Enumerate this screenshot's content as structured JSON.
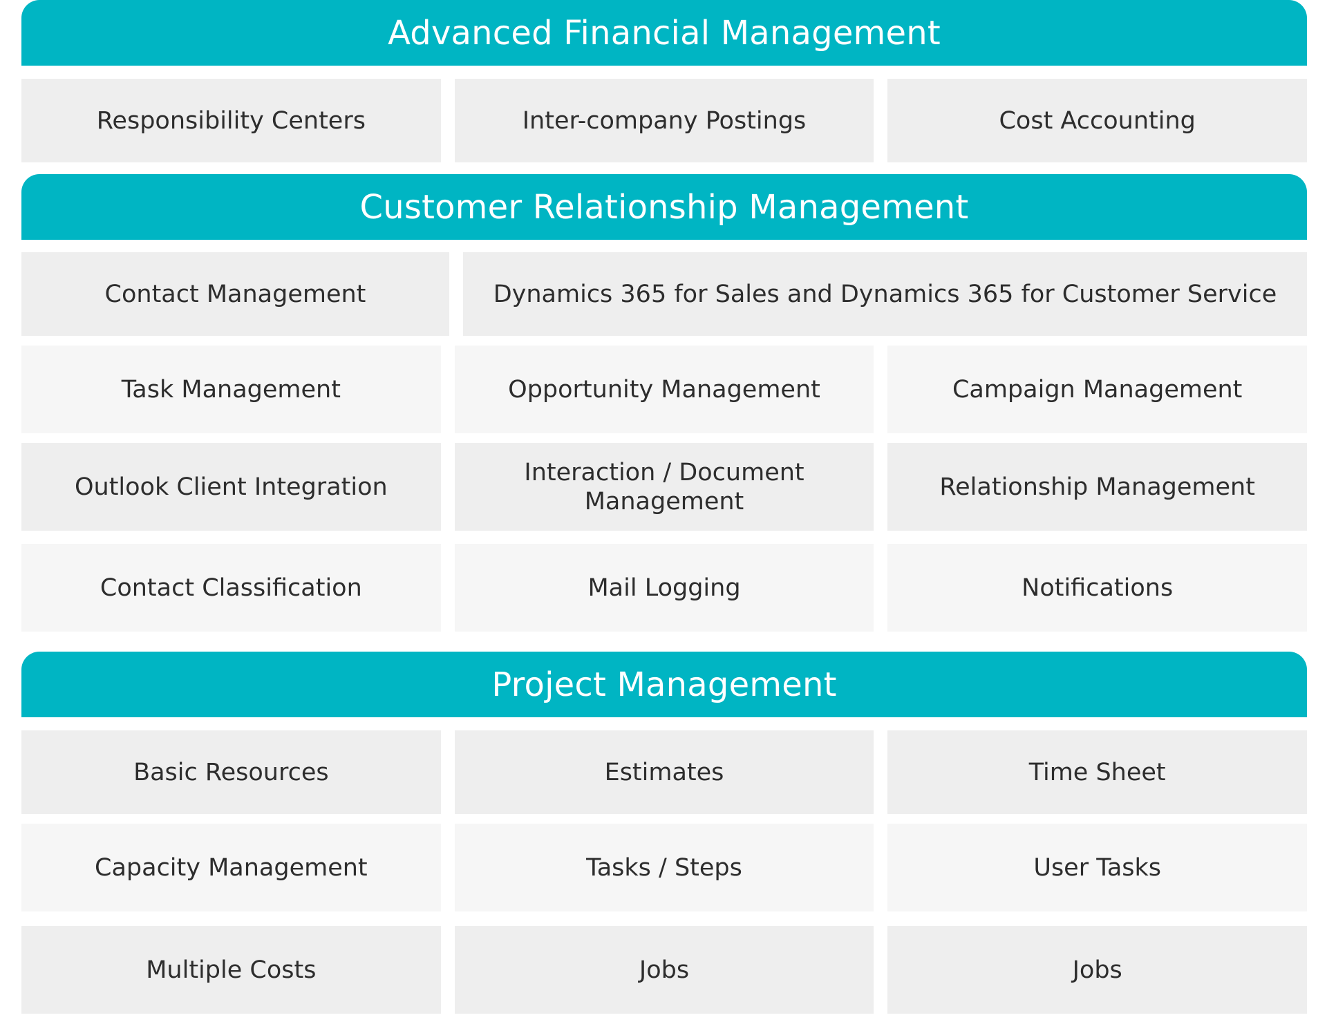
{
  "colors": {
    "header_bg": "#00b5c3",
    "header_text": "#ffffff",
    "cell_dark": "#eeeeee",
    "cell_light": "#f6f6f6",
    "cell_text": "#2d2d2d"
  },
  "sections": {
    "afm": {
      "title": "Advanced Financial Management",
      "rows": [
        [
          "Responsibility Centers",
          "Inter-company Postings",
          "Cost Accounting"
        ]
      ]
    },
    "crm": {
      "title": "Customer Relationship Management",
      "rows": [
        [
          "Contact Management",
          "Dynamics 365 for Sales and Dynamics 365 for Customer Service"
        ],
        [
          "Task Management",
          "Opportunity Management",
          "Campaign Management"
        ],
        [
          "Outlook Client Integration",
          "Interaction / Document Management",
          "Relationship Management"
        ],
        [
          "Contact Classification",
          "Mail Logging",
          "Notifications"
        ]
      ]
    },
    "pm": {
      "title": "Project Management",
      "rows": [
        [
          "Basic Resources",
          "Estimates",
          "Time Sheet"
        ],
        [
          "Capacity Management",
          "Tasks / Steps",
          "User Tasks"
        ],
        [
          "Multiple Costs",
          "Jobs",
          "Jobs"
        ]
      ]
    }
  }
}
